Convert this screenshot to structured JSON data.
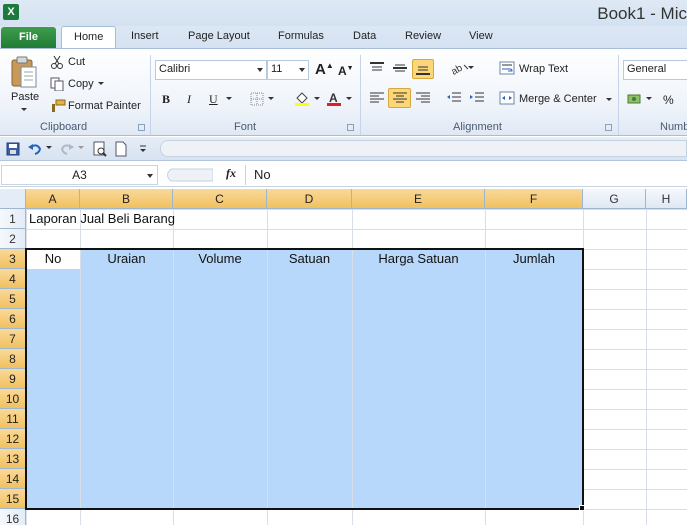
{
  "window": {
    "title": "Book1 - Mic"
  },
  "tabs": {
    "file": "File",
    "items": [
      "Home",
      "Insert",
      "Page Layout",
      "Formulas",
      "Data",
      "Review",
      "View"
    ]
  },
  "clipboard": {
    "paste": "Paste",
    "cut": "Cut",
    "copy": "Copy",
    "format_painter": "Format Painter",
    "label": "Clipboard"
  },
  "font": {
    "name": "Calibri",
    "size": "11",
    "label": "Font",
    "bold": "B",
    "italic": "I",
    "underline": "U"
  },
  "alignment": {
    "wrap_text": "Wrap Text",
    "merge_center": "Merge & Center",
    "label": "Alignment"
  },
  "number": {
    "format": "General",
    "label": "Numb",
    "percent": "%"
  },
  "formula_bar": {
    "name_box": "A3",
    "fx": "fx",
    "content": "No"
  },
  "sheet": {
    "columns": [
      "A",
      "B",
      "C",
      "D",
      "E",
      "F",
      "G",
      "H"
    ],
    "rows": [
      "1",
      "2",
      "3",
      "4",
      "5",
      "6",
      "7",
      "8",
      "9",
      "10",
      "11",
      "12",
      "13",
      "14",
      "15",
      "16"
    ],
    "a1": "Laporan Jual Beli Barang",
    "headers": [
      "No",
      "Uraian",
      "Volume",
      "Satuan",
      "Harga Satuan",
      "Jumlah"
    ]
  }
}
